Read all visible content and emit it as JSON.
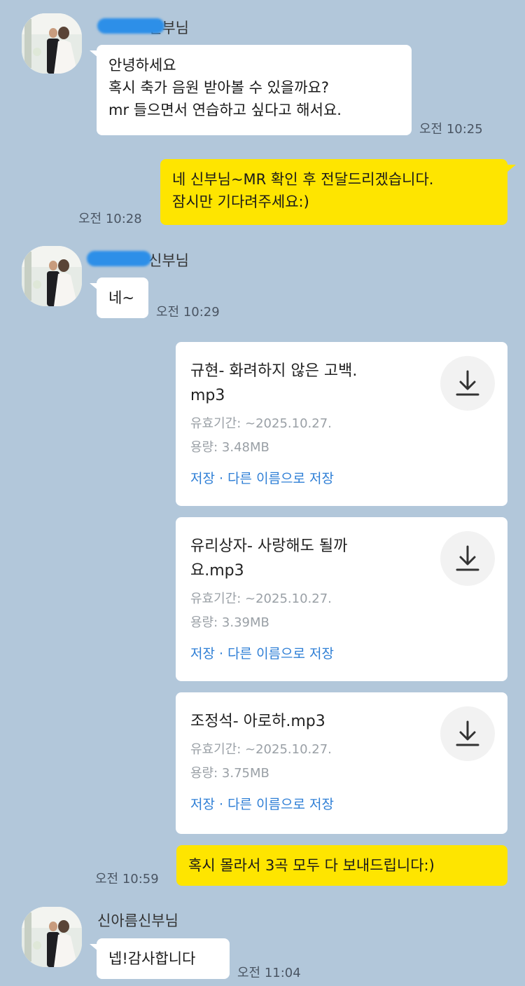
{
  "colors": {
    "background": "#b2c7da",
    "bubble_in": "#ffffff",
    "bubble_out": "#fee500",
    "link": "#2f7fd6"
  },
  "messages": {
    "m1": {
      "sender": "신부님",
      "text": "안녕하세요\n혹시 축가 음원 받아볼 수 있을까요?\nmr 들으면서 연습하고 싶다고 해서요.",
      "time": "오전 10:25"
    },
    "m2": {
      "text": "네 신부님~MR 확인 후 전달드리겠습니다.\n잠시만 기다려주세요:)",
      "time": "오전 10:28"
    },
    "m3": {
      "sender": "신부님",
      "text": "네~",
      "time": "오전 10:29"
    },
    "m4": {
      "text": "혹시 몰라서 3곡 모두 다 보내드립니다:)",
      "time": "오전 10:59"
    },
    "m5": {
      "sender": "신아름신부님",
      "text": "넵!감사합니다",
      "time": "오전 11:04"
    }
  },
  "files": [
    {
      "name": "규현- 화려하지 않은 고백.\nmp3",
      "expiry": "유효기간: ~2025.10.27.",
      "size": "용량: 3.48MB",
      "actions": "저장 · 다른 이름으로 저장"
    },
    {
      "name": "유리상자- 사랑해도 될까\n요.mp3",
      "expiry": "유효기간: ~2025.10.27.",
      "size": "용량: 3.39MB",
      "actions": "저장 · 다른 이름으로 저장"
    },
    {
      "name": "조정석- 아로하.mp3",
      "expiry": "유효기간: ~2025.10.27.",
      "size": "용량: 3.75MB",
      "actions": "저장 · 다른 이름으로 저장"
    }
  ],
  "icons": {
    "avatar": "wedding-photo-avatar",
    "download": "download-icon",
    "redaction": "blue-scribble-mask"
  }
}
